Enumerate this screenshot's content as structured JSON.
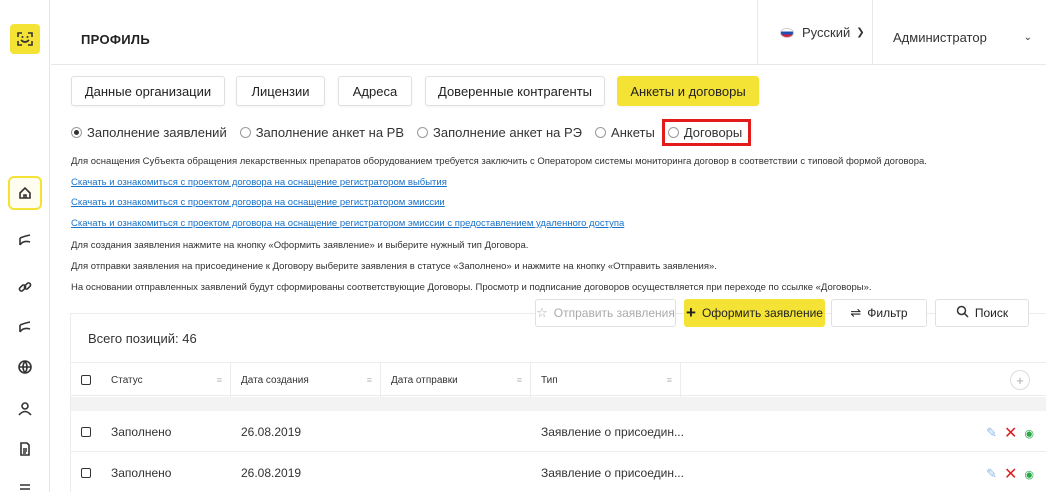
{
  "header": {
    "title": "ПРОФИЛЬ",
    "language": "Русский",
    "user": "Администратор"
  },
  "tabs": [
    {
      "label": "Данные организации",
      "active": false
    },
    {
      "label": "Лицензии",
      "active": false
    },
    {
      "label": "Адреса",
      "active": false
    },
    {
      "label": "Доверенные контрагенты",
      "active": false
    },
    {
      "label": "Анкеты и договоры",
      "active": true
    }
  ],
  "radios": [
    {
      "label": "Заполнение заявлений",
      "checked": true
    },
    {
      "label": "Заполнение анкет на РВ",
      "checked": false
    },
    {
      "label": "Заполнение анкет на РЭ",
      "checked": false
    },
    {
      "label": "Анкеты",
      "checked": false
    },
    {
      "label": "Договоры",
      "checked": false,
      "highlighted": true
    }
  ],
  "info": {
    "intro": "Для оснащения Субъекта обращения лекарственных препаратов оборудованием требуется заключить с Оператором системы мониторинга договор в соответствии с типовой формой договора.",
    "link1": "Скачать и ознакомиться с проектом договора на оснащение регистратором выбытия",
    "link2": "Скачать и ознакомиться с проектом договора на оснащение регистратором эмиссии",
    "link3": "Скачать и ознакомиться с проектом договора на оснащение регистратором эмиссии с предоставлением удаленного доступа",
    "line1": "Для создания заявления нажмите на кнопку «Оформить заявление» и выберите нужный тип Договора.",
    "line2": "Для отправки заявления на присоединение к Договору выберите заявления в статусе «Заполнено» и нажмите на кнопку «Отправить заявления».",
    "line3": "На основании отправленных заявлений будут сформированы соответствующие Договоры. Просмотр и подписание договоров осуществляется при переходе по ссылке «Договоры»."
  },
  "actions": {
    "send": "Отправить заявления",
    "create": "Оформить заявление",
    "filter": "Фильтр",
    "search": "Поиск"
  },
  "table": {
    "total": "Всего позиций: 46",
    "columns": [
      "Статус",
      "Дата создания",
      "Дата отправки",
      "Тип"
    ],
    "rows": [
      {
        "status": "Заполнено",
        "created": "26.08.2019",
        "sent": "",
        "type": "Заявление о присоедин..."
      },
      {
        "status": "Заполнено",
        "created": "26.08.2019",
        "sent": "",
        "type": "Заявление о присоедин..."
      }
    ]
  },
  "colors": {
    "accent": "#f4e234",
    "link": "#1a73c9",
    "highlight": "#e31b1b",
    "delete": "#e02020",
    "view": "#2aa84a"
  },
  "icons": {
    "logo": "smile-logo",
    "sidebar": [
      "home-icon",
      "pill-icon",
      "link-icon",
      "pill-icon",
      "globe-icon",
      "user-icon",
      "document-icon"
    ]
  }
}
